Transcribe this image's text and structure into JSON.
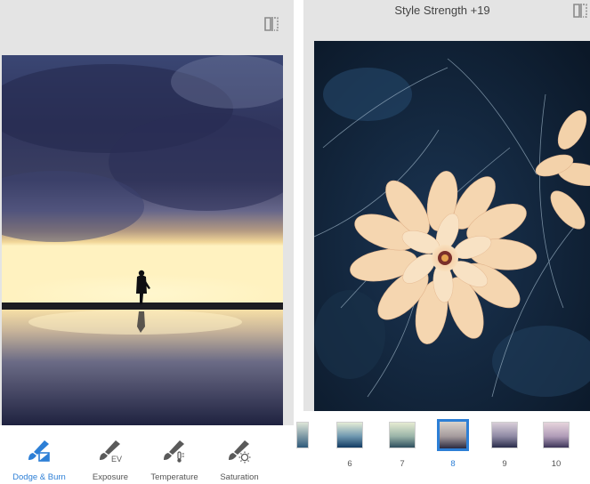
{
  "left_panel": {
    "tools": [
      {
        "label": "Dodge & Burn",
        "icon": "dodge-burn-brush-icon",
        "active": true
      },
      {
        "label": "Exposure",
        "icon": "exposure-brush-icon",
        "active": false
      },
      {
        "label": "Temperature",
        "icon": "temperature-brush-icon",
        "active": false
      },
      {
        "label": "Saturation",
        "icon": "saturation-brush-icon",
        "active": false
      }
    ],
    "exposure_badge": "EV"
  },
  "right_panel": {
    "title": "Style Strength +19",
    "styles": [
      "6",
      "7",
      "8",
      "9",
      "10"
    ],
    "selected_style": "8"
  },
  "colors": {
    "accent": "#2d7fd6",
    "chrome": "#e4e4e4"
  }
}
